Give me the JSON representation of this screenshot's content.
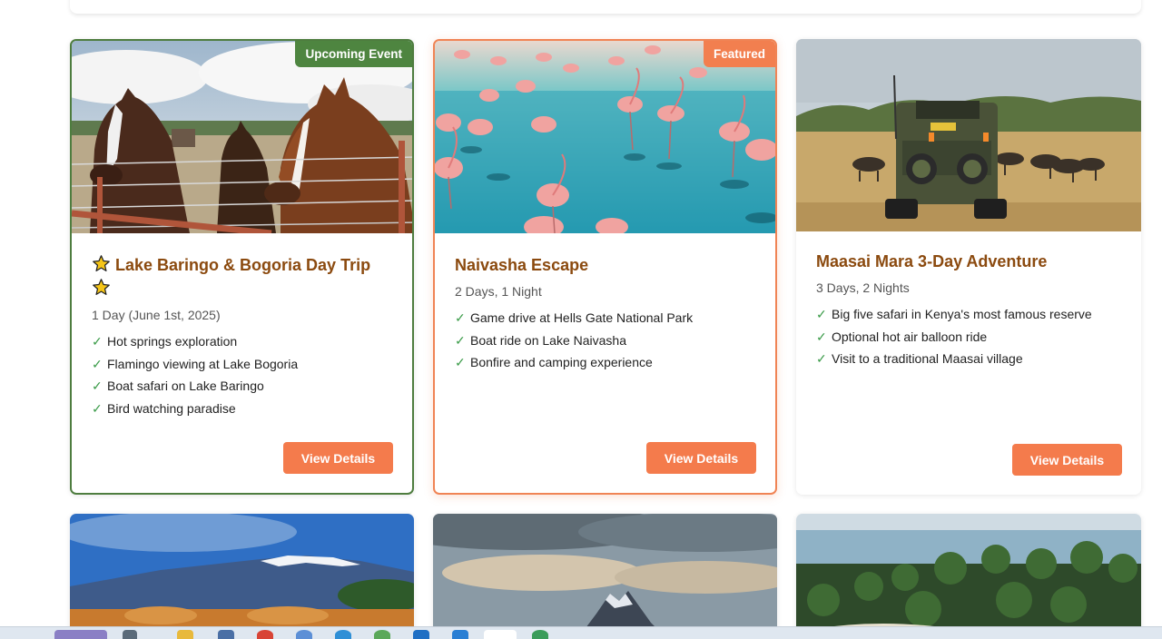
{
  "cards": [
    {
      "badge": "Upcoming Event",
      "title": "Lake Baringo & Bogoria Day Trip",
      "duration": "1 Day (June 1st, 2025)",
      "features": [
        "Hot springs exploration",
        "Flamingo viewing at Lake Bogoria",
        "Boat safari on Lake Baringo",
        "Bird watching paradise"
      ],
      "button": "View Details"
    },
    {
      "badge": "Featured",
      "title": "Naivasha Escape",
      "duration": "2 Days, 1 Night",
      "features": [
        "Game drive at Hells Gate National Park",
        "Boat ride on Lake Naivasha",
        "Bonfire and camping experience"
      ],
      "button": "View Details"
    },
    {
      "title": "Maasai Mara 3-Day Adventure",
      "duration": "3 Days, 2 Nights",
      "features": [
        "Big five safari in Kenya's most famous reserve",
        "Optional hot air balloon ride",
        "Visit to a traditional Maasai village"
      ],
      "button": "View Details"
    }
  ],
  "colors": {
    "accent": "#f47b4c",
    "title": "#8b4a0f",
    "upcoming": "#4e8540",
    "check": "#3c9c4a"
  },
  "icons": {
    "check": "✓",
    "star": "star-icon"
  }
}
